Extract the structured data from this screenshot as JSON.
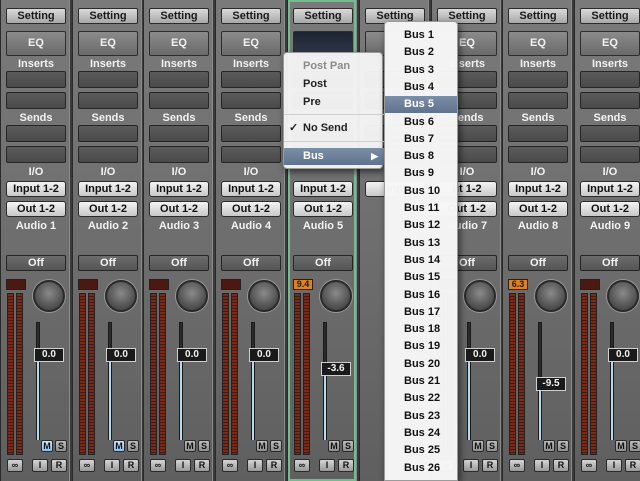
{
  "strips": [
    {
      "setting": "Setting",
      "eq": "EQ",
      "inserts": "Inserts",
      "sends": "Sends",
      "io": "I/O",
      "input": "Input 1-2",
      "output": "Out 1-2",
      "name": "Audio 1",
      "automation": "Off",
      "peak": "",
      "fader": "0.0",
      "m": "M",
      "s": "S",
      "mute_active": true
    },
    {
      "setting": "Setting",
      "eq": "EQ",
      "inserts": "Inserts",
      "sends": "Sends",
      "io": "I/O",
      "input": "Input 1-2",
      "output": "Out 1-2",
      "name": "Audio 2",
      "automation": "Off",
      "peak": "",
      "fader": "0.0",
      "m": "M",
      "s": "S",
      "mute_active": true
    },
    {
      "setting": "Setting",
      "eq": "EQ",
      "inserts": "Inserts",
      "sends": "Sends",
      "io": "I/O",
      "input": "Input 1-2",
      "output": "Out 1-2",
      "name": "Audio 3",
      "automation": "Off",
      "peak": "",
      "fader": "0.0",
      "m": "M",
      "s": "S",
      "mute_active": false
    },
    {
      "setting": "Setting",
      "eq": "EQ",
      "inserts": "Inserts",
      "sends": "Sends",
      "io": "I/O",
      "input": "Input 1-2",
      "output": "Out 1-2",
      "name": "Audio 4",
      "automation": "Off",
      "peak": "",
      "fader": "0.0",
      "m": "M",
      "s": "S",
      "mute_active": false
    },
    {
      "setting": "Setting",
      "eq": "",
      "inserts": "",
      "sends": "",
      "io": "",
      "input": "Input 1-2",
      "output": "Out 1-2",
      "name": "Audio 5",
      "automation": "Off",
      "peak": "9.4",
      "fader": "-3.6",
      "m": "M",
      "s": "S",
      "mute_active": false
    },
    {
      "setting": "Setting",
      "eq": "",
      "inserts": "",
      "sends": "",
      "io": "",
      "input": "Inp",
      "output": "",
      "name": "",
      "automation": "",
      "peak": "",
      "fader": "",
      "m": "",
      "s": "",
      "mute_active": false
    },
    {
      "setting": "Setting",
      "eq": "EQ",
      "inserts": "Inserts",
      "sends": "Sends",
      "io": "I/O",
      "input": "ut 1-2",
      "output": "Out 1-2",
      "name": "Audio 7",
      "automation": "Off",
      "peak": "",
      "fader": "0.0",
      "m": "M",
      "s": "S",
      "mute_active": false
    },
    {
      "setting": "Setting",
      "eq": "EQ",
      "inserts": "Inserts",
      "sends": "Sends",
      "io": "I/O",
      "input": "Input 1-2",
      "output": "Out 1-2",
      "name": "Audio 8",
      "automation": "Off",
      "peak": "6.3",
      "fader": "-9.5",
      "m": "M",
      "s": "S",
      "mute_active": false
    },
    {
      "setting": "Setting",
      "eq": "EQ",
      "inserts": "Inserts",
      "sends": "Sends",
      "io": "I/O",
      "input": "Input 1-2",
      "output": "Out 1-2",
      "name": "Audio 9",
      "automation": "Off",
      "peak": "",
      "fader": "0.0",
      "m": "M",
      "s": "S",
      "mute_active": false
    }
  ],
  "bottom_buttons": {
    "link": "∞",
    "input_monitor": "I",
    "record": "R"
  },
  "send_menu": {
    "items": [
      "Post Pan",
      "Post",
      "Pre",
      "No Send",
      "Bus"
    ],
    "checked": "No Send",
    "submenu_arrow": "▶",
    "check_mark": "✓"
  },
  "bus_menu": {
    "items": [
      "Bus 1",
      "Bus 2",
      "Bus 3",
      "Bus 4",
      "Bus 5",
      "Bus 6",
      "Bus 7",
      "Bus 8",
      "Bus 9",
      "Bus 10",
      "Bus 11",
      "Bus 12",
      "Bus 13",
      "Bus 14",
      "Bus 15",
      "Bus 16",
      "Bus 17",
      "Bus 18",
      "Bus 19",
      "Bus 20",
      "Bus 21",
      "Bus 22",
      "Bus 23",
      "Bus 24",
      "Bus 25",
      "Bus 26"
    ],
    "highlighted": "Bus 5"
  },
  "colors": {
    "accent_highlight": "#6b7f9c",
    "peak_hot": "#e0821c",
    "selected_strip_border": "#6fbf8c",
    "mute_active": "#8dc0ea"
  }
}
